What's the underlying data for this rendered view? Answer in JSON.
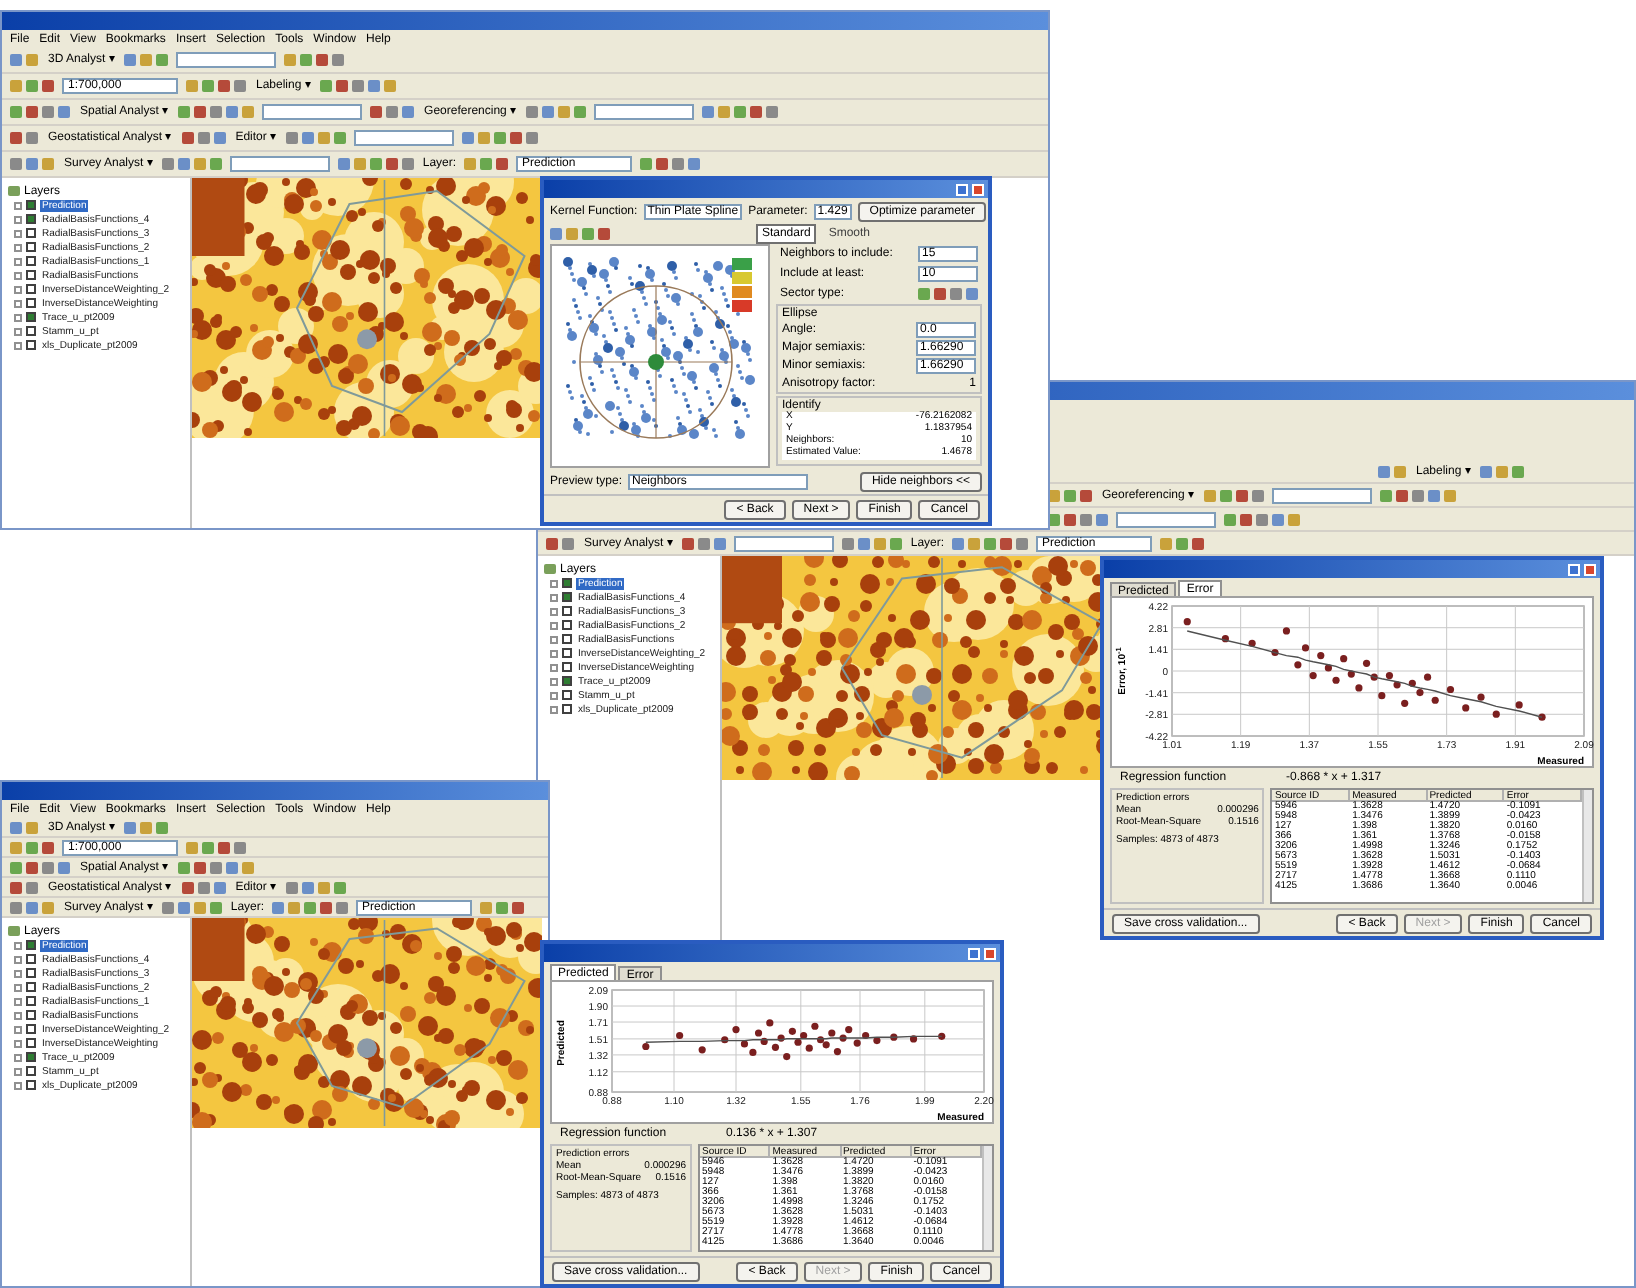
{
  "windows": [
    {
      "menu": [
        "File",
        "Edit",
        "View",
        "Bookmarks",
        "Insert",
        "Selection",
        "Tools",
        "Window",
        "Help"
      ],
      "toolbars": [
        [
          {
            "kind": "menu",
            "label": "3D Analyst ▾"
          },
          {
            "kind": "field"
          }
        ],
        [
          {
            "kind": "combo",
            "value": "1:700,000"
          },
          {
            "kind": "menu",
            "label": "Labeling ▾"
          }
        ],
        [
          {
            "kind": "menu",
            "label": "Spatial Analyst ▾"
          },
          {
            "kind": "field"
          },
          {
            "kind": "menu",
            "label": "Georeferencing ▾"
          },
          {
            "kind": "field"
          }
        ],
        [
          {
            "kind": "menu",
            "label": "Geostatistical Analyst ▾"
          },
          {
            "kind": "menu",
            "label": "Editor ▾"
          },
          {
            "kind": "field"
          }
        ],
        [
          {
            "kind": "menu",
            "label": "Survey Analyst ▾"
          },
          {
            "kind": "field"
          },
          {
            "kind": "label",
            "label": "Layer:"
          },
          {
            "kind": "combo",
            "value": "Prediction"
          }
        ]
      ],
      "toc": {
        "title": "Layers",
        "layers": [
          {
            "name": "Prediction",
            "checked": true,
            "selected": true
          },
          {
            "name": "RadialBasisFunctions_4",
            "checked": true,
            "selected": false
          },
          {
            "name": "RadialBasisFunctions_3",
            "checked": false,
            "selected": false
          },
          {
            "name": "RadialBasisFunctions_2",
            "checked": false,
            "selected": false
          },
          {
            "name": "RadialBasisFunctions_1",
            "checked": false,
            "selected": false
          },
          {
            "name": "RadialBasisFunctions",
            "checked": false,
            "selected": false
          },
          {
            "name": "InverseDistanceWeighting_2",
            "checked": false,
            "selected": false
          },
          {
            "name": "InverseDistanceWeighting",
            "checked": false,
            "selected": false
          },
          {
            "name": "Trace_u_pt2009",
            "checked": true,
            "selected": false
          },
          {
            "name": "Stamm_u_pt",
            "checked": false,
            "selected": false
          },
          {
            "name": "xls_Duplicate_pt2009",
            "checked": false,
            "selected": false
          }
        ]
      }
    },
    {
      "toolbars": [
        [
          {
            "kind": "menu",
            "label": "Labeling ▾"
          }
        ],
        [
          {
            "kind": "menu",
            "label": "Georeferencing ▾"
          },
          {
            "kind": "field"
          }
        ],
        [
          {
            "kind": "field"
          }
        ],
        [
          {
            "kind": "menu",
            "label": "Survey Analyst ▾"
          },
          {
            "kind": "field"
          },
          {
            "kind": "label",
            "label": "Layer:"
          },
          {
            "kind": "combo",
            "value": "Prediction"
          }
        ]
      ],
      "toc": {
        "title": "Layers",
        "layers": [
          {
            "name": "Prediction",
            "checked": true,
            "selected": true
          },
          {
            "name": "RadialBasisFunctions_4",
            "checked": true,
            "selected": false
          },
          {
            "name": "RadialBasisFunctions_3",
            "checked": false,
            "selected": false
          },
          {
            "name": "RadialBasisFunctions_2",
            "checked": false,
            "selected": false
          },
          {
            "name": "RadialBasisFunctions",
            "checked": false,
            "selected": false
          },
          {
            "name": "InverseDistanceWeighting_2",
            "checked": false,
            "selected": false
          },
          {
            "name": "InverseDistanceWeighting",
            "checked": false,
            "selected": false
          },
          {
            "name": "Trace_u_pt2009",
            "checked": true,
            "selected": false
          },
          {
            "name": "Stamm_u_pt",
            "checked": false,
            "selected": false
          },
          {
            "name": "xls_Duplicate_pt2009",
            "checked": false,
            "selected": false
          }
        ]
      }
    },
    {
      "menu": [
        "File",
        "Edit",
        "View",
        "Bookmarks",
        "Insert",
        "Selection",
        "Tools",
        "Window",
        "Help"
      ],
      "toolbars": [
        [
          {
            "kind": "menu",
            "label": "3D Analyst ▾"
          }
        ],
        [
          {
            "kind": "combo",
            "value": "1:700,000"
          }
        ],
        [
          {
            "kind": "menu",
            "label": "Spatial Analyst ▾"
          }
        ],
        [
          {
            "kind": "menu",
            "label": "Geostatistical Analyst ▾"
          },
          {
            "kind": "menu",
            "label": "Editor ▾"
          }
        ],
        [
          {
            "kind": "menu",
            "label": "Survey Analyst ▾"
          },
          {
            "kind": "label",
            "label": "Layer:"
          },
          {
            "kind": "combo",
            "value": "Prediction"
          }
        ]
      ],
      "toc": {
        "title": "Layers",
        "layers": [
          {
            "name": "Prediction",
            "checked": true,
            "selected": true
          },
          {
            "name": "RadialBasisFunctions_4",
            "checked": false,
            "selected": false
          },
          {
            "name": "RadialBasisFunctions_3",
            "checked": false,
            "selected": false
          },
          {
            "name": "RadialBasisFunctions_2",
            "checked": false,
            "selected": false
          },
          {
            "name": "RadialBasisFunctions_1",
            "checked": false,
            "selected": false
          },
          {
            "name": "RadialBasisFunctions",
            "checked": false,
            "selected": false
          },
          {
            "name": "InverseDistanceWeighting_2",
            "checked": false,
            "selected": false
          },
          {
            "name": "InverseDistanceWeighting",
            "checked": false,
            "selected": false
          },
          {
            "name": "Trace_u_pt2009",
            "checked": true,
            "selected": false
          },
          {
            "name": "Stamm_u_pt",
            "checked": false,
            "selected": false
          },
          {
            "name": "xls_Duplicate_pt2009",
            "checked": false,
            "selected": false
          }
        ]
      }
    }
  ],
  "dialogs": [
    {
      "kind": "neighborhood",
      "kernel_label": "Kernel Function:",
      "kernel": "Thin Plate Spline",
      "parameter_label": "Parameter:",
      "parameter": "1.429",
      "optimize": "Optimize parameter",
      "modes": [
        {
          "label": "Standard",
          "selected": true
        },
        {
          "label": "Smooth",
          "selected": false
        }
      ],
      "settings": [
        {
          "kind": "spin",
          "label": "Neighbors to include:",
          "value": "15"
        },
        {
          "kind": "spin",
          "label": "Include at least:",
          "value": "10"
        },
        {
          "kind": "sectors",
          "label": "Sector type:"
        }
      ],
      "ellipse": {
        "title": "Ellipse",
        "fields": [
          {
            "kind": "spin",
            "label": "Angle:",
            "value": "0.0"
          },
          {
            "kind": "field",
            "label": "Major semiaxis:",
            "value": "1.66290"
          },
          {
            "kind": "field",
            "label": "Minor semiaxis:",
            "value": "1.66290"
          },
          {
            "kind": "text",
            "label": "Anisotropy factor:",
            "value": "1"
          }
        ]
      },
      "identify": {
        "title": "Identify",
        "rows": [
          {
            "label": "X",
            "value": "-76.2162082"
          },
          {
            "label": "Y",
            "value": "1.1837954"
          },
          {
            "label": "Neighbors:",
            "value": "10"
          },
          {
            "label": "Estimated Value:",
            "value": "1.4678"
          }
        ]
      },
      "preview_label": "Preview type:",
      "preview": "Neighbors",
      "hide": "Hide neighbors <<",
      "buttons": [
        {
          "label": "< Back",
          "disabled": false
        },
        {
          "label": "Next >",
          "disabled": false
        },
        {
          "label": "Finish",
          "disabled": false
        },
        {
          "label": "Cancel",
          "disabled": false
        }
      ]
    },
    {
      "kind": "cross_validation",
      "tabs": [
        {
          "label": "Predicted",
          "selected": false
        },
        {
          "label": "Error",
          "selected": true
        }
      ],
      "chart_data": {
        "type": "scatter",
        "grid": true,
        "xlabel": "Measured",
        "ylabel": "Error, 10$^{-1}$",
        "xlim": [
          1.01,
          2.09
        ],
        "ylim": [
          -4.22,
          4.22
        ],
        "xticks": [
          {
            "value": 1.01,
            "label": "1.01"
          },
          {
            "value": 1.19,
            "label": "1.19"
          },
          {
            "value": 1.37,
            "label": "1.37"
          },
          {
            "value": 1.55,
            "label": "1.55"
          },
          {
            "value": 1.73,
            "label": "1.73"
          },
          {
            "value": 1.91,
            "label": "1.91"
          },
          {
            "value": 2.09,
            "label": "2.09"
          }
        ],
        "yticks": [
          {
            "value": -4.22,
            "label": "-4.22"
          },
          {
            "value": -2.81,
            "label": "-2.81"
          },
          {
            "value": -1.41,
            "label": "-1.41"
          },
          {
            "value": 0,
            "label": "0"
          },
          {
            "value": 1.41,
            "label": "1.41"
          },
          {
            "value": 2.81,
            "label": "2.81"
          },
          {
            "value": 4.22,
            "label": "4.22"
          }
        ],
        "x": [
          1.05,
          1.15,
          1.22,
          1.28,
          1.31,
          1.34,
          1.36,
          1.38,
          1.4,
          1.42,
          1.44,
          1.46,
          1.48,
          1.5,
          1.52,
          1.54,
          1.56,
          1.58,
          1.6,
          1.62,
          1.64,
          1.66,
          1.68,
          1.7,
          1.74,
          1.78,
          1.82,
          1.86,
          1.92,
          1.98
        ],
        "series": [
          {
            "type": "scatter",
            "color": "#7a1f1f",
            "values": [
              3.2,
              2.1,
              1.8,
              1.2,
              2.6,
              0.4,
              1.5,
              -0.3,
              1.0,
              0.2,
              -0.6,
              0.8,
              -0.2,
              -1.1,
              0.5,
              -0.4,
              -1.6,
              -0.3,
              -0.9,
              -2.1,
              -0.8,
              -1.4,
              -0.4,
              -1.9,
              -1.2,
              -2.4,
              -1.7,
              -2.8,
              -2.2,
              -3.0
            ]
          },
          {
            "type": "line",
            "color": "#505050",
            "values": [
              2.6,
              2.0,
              1.6,
              1.2,
              1.0,
              0.9,
              0.7,
              0.6,
              0.5,
              0.4,
              0.3,
              0.1,
              0.0,
              -0.1,
              -0.2,
              -0.4,
              -0.5,
              -0.6,
              -0.7,
              -0.8,
              -1.0,
              -1.1,
              -1.2,
              -1.3,
              -1.6,
              -1.8,
              -2.0,
              -2.3,
              -2.6,
              -3.0
            ]
          }
        ]
      },
      "regression_label": "Regression function",
      "regression": "-0.868 * x + 1.317",
      "errors_title": "Prediction errors",
      "stats": [
        {
          "label": "Mean",
          "value": "0.000296"
        },
        {
          "label": "Root-Mean-Square",
          "value": "0.1516"
        }
      ],
      "samples": "Samples: 4873 of 4873",
      "table": {
        "columns": [
          "Source ID",
          "Measured",
          "Predicted",
          "Error"
        ],
        "rows": [
          [
            "5946",
            "1.3628",
            "1.4720",
            "-0.1091"
          ],
          [
            "5948",
            "1.3476",
            "1.3899",
            "-0.0423"
          ],
          [
            "127",
            "1.398",
            "1.3820",
            "0.0160"
          ],
          [
            "366",
            "1.361",
            "1.3768",
            "-0.0158"
          ],
          [
            "3206",
            "1.4998",
            "1.3246",
            "0.1752"
          ],
          [
            "5673",
            "1.3628",
            "1.5031",
            "-0.1403"
          ],
          [
            "5519",
            "1.3928",
            "1.4612",
            "-0.0684"
          ],
          [
            "2717",
            "1.4778",
            "1.3668",
            "0.1110"
          ],
          [
            "4125",
            "1.3686",
            "1.3640",
            "0.0046"
          ]
        ]
      },
      "save": "Save cross validation...",
      "buttons": [
        {
          "label": "< Back",
          "disabled": false
        },
        {
          "label": "Next >",
          "disabled": true
        },
        {
          "label": "Finish",
          "disabled": false
        },
        {
          "label": "Cancel",
          "disabled": false
        }
      ]
    },
    {
      "kind": "cross_validation",
      "tabs": [
        {
          "label": "Predicted",
          "selected": true
        },
        {
          "label": "Error",
          "selected": false
        }
      ],
      "chart_data": {
        "type": "scatter",
        "grid": true,
        "xlabel": "Measured",
        "ylabel": "Predicted",
        "xlim": [
          0.88,
          2.2
        ],
        "ylim": [
          0.88,
          2.09
        ],
        "xticks": [
          {
            "value": 0.88,
            "label": "0.88"
          },
          {
            "value": 1.1,
            "label": "1.10"
          },
          {
            "value": 1.32,
            "label": "1.32"
          },
          {
            "value": 1.55,
            "label": "1.55"
          },
          {
            "value": 1.76,
            "label": "1.76"
          },
          {
            "value": 1.99,
            "label": "1.99"
          },
          {
            "value": 2.2,
            "label": "2.20"
          }
        ],
        "yticks": [
          {
            "value": 0.88,
            "label": "0.88"
          },
          {
            "value": 1.12,
            "label": "1.12"
          },
          {
            "value": 1.32,
            "label": "1.32"
          },
          {
            "value": 1.51,
            "label": "1.51"
          },
          {
            "value": 1.71,
            "label": "1.71"
          },
          {
            "value": 1.9,
            "label": "1.90"
          },
          {
            "value": 2.09,
            "label": "2.09"
          }
        ],
        "x": [
          1.0,
          1.12,
          1.2,
          1.28,
          1.32,
          1.35,
          1.38,
          1.4,
          1.42,
          1.44,
          1.46,
          1.48,
          1.5,
          1.52,
          1.54,
          1.56,
          1.58,
          1.6,
          1.62,
          1.64,
          1.66,
          1.68,
          1.7,
          1.72,
          1.75,
          1.78,
          1.82,
          1.88,
          1.95,
          2.05
        ],
        "series": [
          {
            "type": "scatter",
            "color": "#7a1f1f",
            "values": [
              1.42,
              1.55,
              1.38,
              1.5,
              1.62,
              1.45,
              1.35,
              1.58,
              1.48,
              1.7,
              1.41,
              1.52,
              1.3,
              1.6,
              1.47,
              1.55,
              1.4,
              1.66,
              1.5,
              1.44,
              1.58,
              1.36,
              1.52,
              1.62,
              1.46,
              1.55,
              1.49,
              1.53,
              1.51,
              1.54
            ]
          },
          {
            "type": "line",
            "color": "#505050",
            "values": [
              1.47,
              1.48,
              1.48,
              1.49,
              1.49,
              1.49,
              1.5,
              1.5,
              1.5,
              1.5,
              1.5,
              1.5,
              1.51,
              1.51,
              1.51,
              1.51,
              1.51,
              1.51,
              1.51,
              1.51,
              1.52,
              1.52,
              1.52,
              1.52,
              1.52,
              1.52,
              1.53,
              1.53,
              1.54,
              1.54
            ]
          }
        ]
      },
      "regression_label": "Regression function",
      "regression": "0.136 * x + 1.307",
      "errors_title": "Prediction errors",
      "stats": [
        {
          "label": "Mean",
          "value": "0.000296"
        },
        {
          "label": "Root-Mean-Square",
          "value": "0.1516"
        }
      ],
      "samples": "Samples: 4873 of 4873",
      "table": {
        "columns": [
          "Source ID",
          "Measured",
          "Predicted",
          "Error"
        ],
        "rows": [
          [
            "5946",
            "1.3628",
            "1.4720",
            "-0.1091"
          ],
          [
            "5948",
            "1.3476",
            "1.3899",
            "-0.0423"
          ],
          [
            "127",
            "1.398",
            "1.3820",
            "0.0160"
          ],
          [
            "366",
            "1.361",
            "1.3768",
            "-0.0158"
          ],
          [
            "3206",
            "1.4998",
            "1.3246",
            "0.1752"
          ],
          [
            "5673",
            "1.3628",
            "1.5031",
            "-0.1403"
          ],
          [
            "5519",
            "1.3928",
            "1.4612",
            "-0.0684"
          ],
          [
            "2717",
            "1.4778",
            "1.3668",
            "0.1110"
          ],
          [
            "4125",
            "1.3686",
            "1.3640",
            "0.0046"
          ]
        ]
      },
      "save": "Save cross validation...",
      "buttons": [
        {
          "label": "< Back",
          "disabled": false
        },
        {
          "label": "Next >",
          "disabled": true
        },
        {
          "label": "Finish",
          "disabled": false
        },
        {
          "label": "Cancel",
          "disabled": false
        }
      ]
    }
  ]
}
